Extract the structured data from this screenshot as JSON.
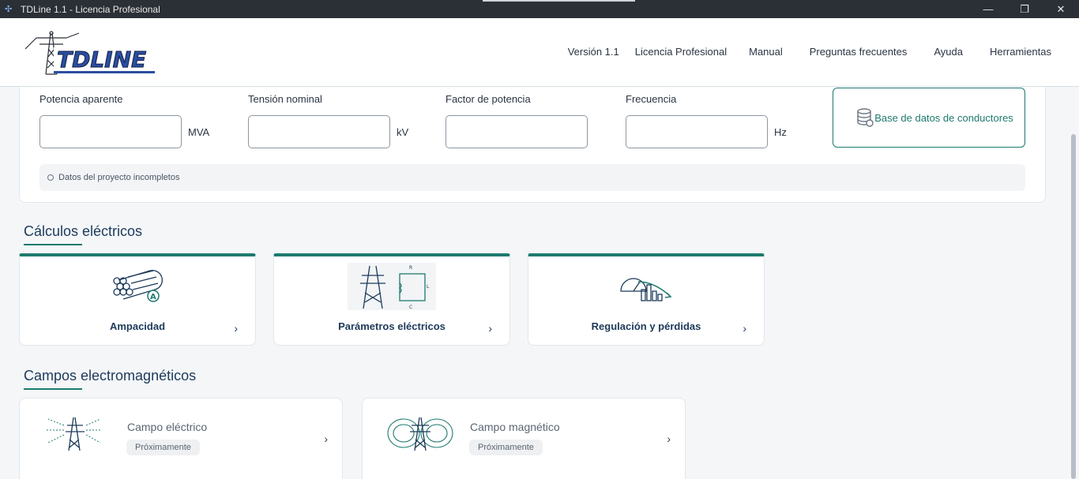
{
  "window": {
    "title": "TDLine 1.1 - Licencia Profesional",
    "minimize": "—",
    "maximize": "❐",
    "close": "✕"
  },
  "header": {
    "logo_text": "TDLINE",
    "nav": [
      "Versión 1.1",
      "Licencia Profesional",
      "Manual",
      "Preguntas frecuentes",
      "Ayuda",
      "Herramientas"
    ]
  },
  "project": {
    "fields": [
      {
        "label": "Potencia aparente",
        "value": "",
        "unit": "MVA"
      },
      {
        "label": "Tensión nominal",
        "value": "",
        "unit": "kV"
      },
      {
        "label": "Factor de potencia",
        "value": "",
        "unit": ""
      },
      {
        "label": "Frecuencia",
        "value": "",
        "unit": "Hz"
      }
    ],
    "db_button": "Base de datos de conductores",
    "status": "Datos del proyecto incompletos"
  },
  "calculos": {
    "title": "Cálculos eléctricos",
    "cards": [
      {
        "label": "Ampacidad",
        "icon": "conductor-ampacity-icon"
      },
      {
        "label": "Parámetros eléctricos",
        "icon": "tower-rlc-icon"
      },
      {
        "label": "Regulación y pérdidas",
        "icon": "gauge-losses-icon"
      }
    ]
  },
  "campos": {
    "title": "Campos electromagnéticos",
    "cards": [
      {
        "label": "Campo eléctrico",
        "badge": "Próximamente",
        "icon": "electric-field-tower-icon"
      },
      {
        "label": "Campo magnético",
        "badge": "Próximamente",
        "icon": "magnetic-field-tower-icon"
      }
    ]
  },
  "colors": {
    "accent": "#1e7a6e",
    "heading": "#1d3a5a",
    "titlebar": "#2b2f36"
  }
}
